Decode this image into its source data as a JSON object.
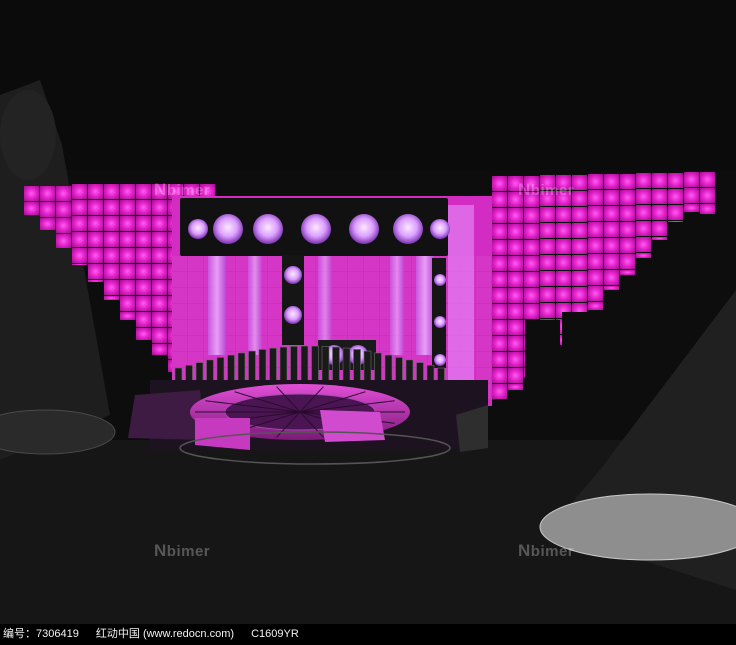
{
  "watermarks": [
    {
      "mark": "N",
      "text": "bimer"
    },
    {
      "mark": "N",
      "text": "bimer"
    },
    {
      "mark": "N",
      "text": "bimer"
    },
    {
      "mark": "N",
      "text": "bimer"
    }
  ],
  "footer": {
    "id_label": "编号：7306419",
    "site": "红动中国 (www.redocn.com)",
    "code": "C1609YR"
  },
  "colors": {
    "magenta": "#e01ec8",
    "magenta_dark": "#9a1490",
    "lavender": "#d9a0ff",
    "background": "#060606"
  }
}
